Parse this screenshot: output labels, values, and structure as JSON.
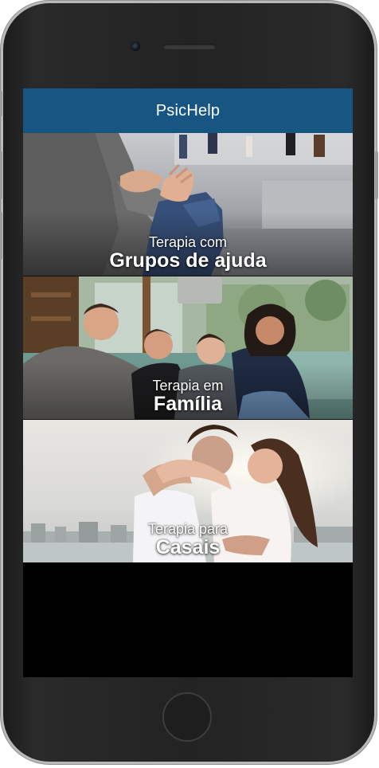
{
  "app": {
    "title": "PsicHelp"
  },
  "cards": [
    {
      "line1": "Terapia com",
      "line2": "Grupos de ajuda",
      "image": "support-group-hands-photo"
    },
    {
      "line1": "Terapia em",
      "line2": "Família",
      "image": "family-on-couch-photo"
    },
    {
      "line1": "Terapia para",
      "line2": "Casais",
      "image": "couple-embracing-photo"
    }
  ],
  "colors": {
    "appbar": "#175582",
    "caption_text": "#ffffff"
  }
}
